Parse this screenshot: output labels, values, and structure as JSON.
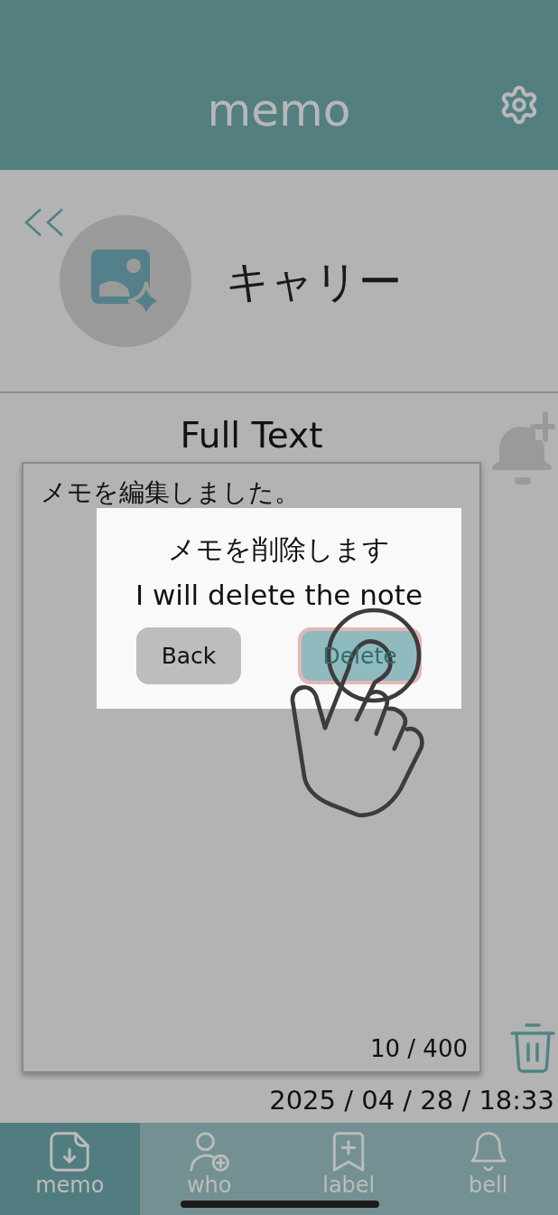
{
  "header": {
    "title": "memo"
  },
  "contact": {
    "name": "キャリー"
  },
  "note": {
    "heading": "Full Text",
    "text": "メモを編集しました。",
    "counter": "10 / 400",
    "timestamp": "2025 / 04 / 28 / 18:33"
  },
  "dialog": {
    "message": "メモを削除します",
    "message_en": "I will delete the note",
    "buttons": [
      {
        "label": "Back",
        "kind": "cancel"
      },
      {
        "label": "Delete",
        "kind": "confirm"
      }
    ]
  },
  "tabs": [
    {
      "label": "memo",
      "selected": true
    },
    {
      "label": "who",
      "selected": false
    },
    {
      "label": "label",
      "selected": false
    },
    {
      "label": "bell",
      "selected": false
    }
  ]
}
